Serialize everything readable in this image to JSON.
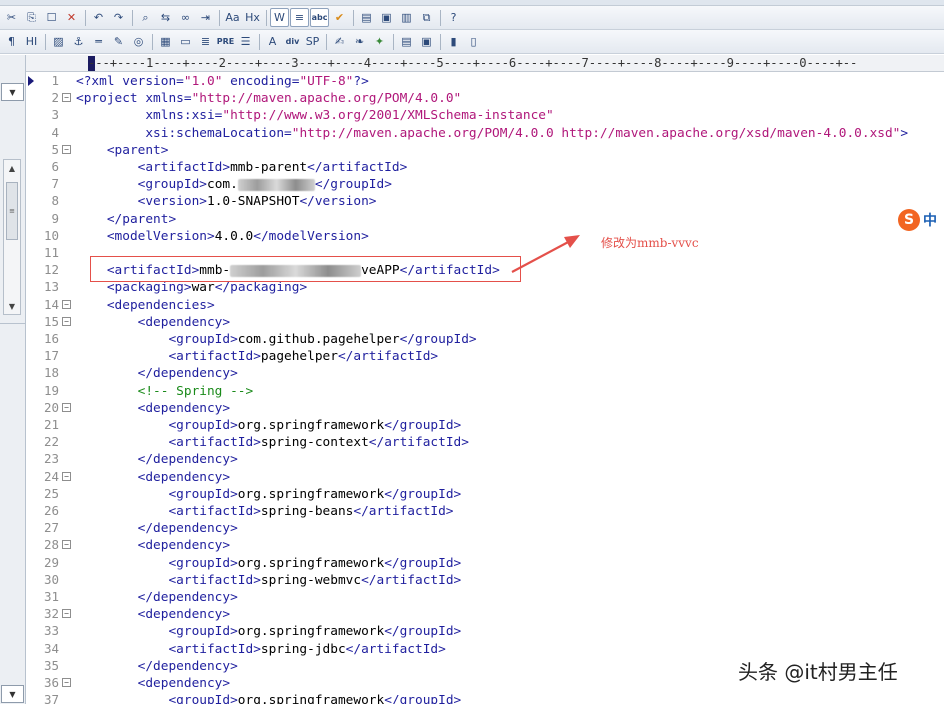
{
  "toolbar_row1": {
    "buttons": [
      {
        "icon": "cut-icon",
        "glyph": "✂"
      },
      {
        "icon": "copy-icon",
        "glyph": "⎘"
      },
      {
        "icon": "paste-icon",
        "glyph": "☐"
      },
      {
        "icon": "delete-icon",
        "glyph": "✕"
      },
      {
        "icon": "undo-icon",
        "glyph": "↶"
      },
      {
        "icon": "redo-icon",
        "glyph": "↷"
      },
      {
        "icon": "find-icon",
        "glyph": "⌕"
      },
      {
        "icon": "replace-icon",
        "glyph": "⇆"
      },
      {
        "icon": "link-icon",
        "glyph": "∞"
      },
      {
        "icon": "indent-icon",
        "glyph": "⇥"
      },
      {
        "icon": "font-icon",
        "glyph": "Aa"
      },
      {
        "icon": "html-icon",
        "glyph": "Hx"
      },
      {
        "icon": "wrap-icon",
        "glyph": "W"
      },
      {
        "icon": "list-icon",
        "glyph": "≡"
      },
      {
        "icon": "abc-icon",
        "glyph": "abc"
      },
      {
        "icon": "spellcheck-icon",
        "glyph": "✔"
      },
      {
        "icon": "view1-icon",
        "glyph": "▤"
      },
      {
        "icon": "view2-icon",
        "glyph": "▣"
      },
      {
        "icon": "view3-icon",
        "glyph": "▥"
      },
      {
        "icon": "window-icon",
        "glyph": "⧉"
      },
      {
        "icon": "help-icon",
        "glyph": "?"
      }
    ]
  },
  "toolbar_row2": {
    "buttons": [
      {
        "icon": "paragraph-icon",
        "glyph": "¶"
      },
      {
        "icon": "heading-icon",
        "glyph": "HI"
      },
      {
        "icon": "image-icon",
        "glyph": "▨"
      },
      {
        "icon": "anchor-icon",
        "glyph": "⚓"
      },
      {
        "icon": "rule-icon",
        "glyph": "═"
      },
      {
        "icon": "edit-icon",
        "glyph": "✎"
      },
      {
        "icon": "color-icon",
        "glyph": "◎"
      },
      {
        "icon": "table-icon",
        "glyph": "▦"
      },
      {
        "icon": "form-icon",
        "glyph": "▭"
      },
      {
        "icon": "align-icon",
        "glyph": "≣"
      },
      {
        "icon": "pre-icon",
        "glyph": "PRE"
      },
      {
        "icon": "ol-icon",
        "glyph": "☰"
      },
      {
        "icon": "format-icon",
        "glyph": "A"
      },
      {
        "icon": "div-icon",
        "glyph": "div"
      },
      {
        "icon": "span-icon",
        "glyph": "SP"
      },
      {
        "icon": "script-icon",
        "glyph": "✍"
      },
      {
        "icon": "style-icon",
        "glyph": "❧"
      },
      {
        "icon": "tools-icon",
        "glyph": "✦"
      },
      {
        "icon": "panel-icon",
        "glyph": "▤"
      },
      {
        "icon": "preview-icon",
        "glyph": "▣"
      },
      {
        "icon": "bookmark-icon",
        "glyph": "▮"
      },
      {
        "icon": "frame-icon",
        "glyph": "▯"
      }
    ]
  },
  "ruler": "---+----1----+----2----+----3----+----4----+----5----+----6----+----7----+----8----+----9----+----0----+--",
  "code_lines": [
    {
      "n": "1",
      "fold": "",
      "parts": [
        {
          "t": "tag",
          "s": "<?xml "
        },
        {
          "t": "attr",
          "s": "version="
        },
        {
          "t": "val",
          "s": "\"1.0\" "
        },
        {
          "t": "attr",
          "s": "encoding="
        },
        {
          "t": "val",
          "s": "\"UTF-8\""
        },
        {
          "t": "tag",
          "s": "?>"
        }
      ]
    },
    {
      "n": "2",
      "fold": "⊟",
      "parts": [
        {
          "t": "tag",
          "s": "<project "
        },
        {
          "t": "attr",
          "s": "xmlns="
        },
        {
          "t": "val",
          "s": "\"http://maven.apache.org/POM/4.0.0\""
        }
      ]
    },
    {
      "n": "3",
      "fold": "",
      "parts": [
        {
          "t": "text",
          "s": "         "
        },
        {
          "t": "attr",
          "s": "xmlns:xsi="
        },
        {
          "t": "val",
          "s": "\"http://www.w3.org/2001/XMLSchema-instance\""
        }
      ]
    },
    {
      "n": "4",
      "fold": "",
      "parts": [
        {
          "t": "text",
          "s": "         "
        },
        {
          "t": "attr",
          "s": "xsi:schemaLocation="
        },
        {
          "t": "val",
          "s": "\"http://maven.apache.org/POM/4.0.0 http://maven.apache.org/xsd/maven-4.0.0.xsd\""
        },
        {
          "t": "tag",
          "s": ">"
        }
      ]
    },
    {
      "n": "5",
      "fold": "⊟",
      "parts": [
        {
          "t": "text",
          "s": "    "
        },
        {
          "t": "tag",
          "s": "<parent>"
        }
      ]
    },
    {
      "n": "6",
      "fold": "",
      "parts": [
        {
          "t": "text",
          "s": "        "
        },
        {
          "t": "tag",
          "s": "<artifactId>"
        },
        {
          "t": "text",
          "s": "mmb-parent"
        },
        {
          "t": "tag",
          "s": "</artifactId>"
        }
      ]
    },
    {
      "n": "7",
      "fold": "",
      "parts": [
        {
          "t": "text",
          "s": "        "
        },
        {
          "t": "tag",
          "s": "<groupId>"
        },
        {
          "t": "text",
          "s": "com."
        },
        {
          "t": "blur",
          "s": "rxxxxxxxxx"
        },
        {
          "t": "tag",
          "s": "</groupId>"
        }
      ]
    },
    {
      "n": "8",
      "fold": "",
      "parts": [
        {
          "t": "text",
          "s": "        "
        },
        {
          "t": "tag",
          "s": "<version>"
        },
        {
          "t": "text",
          "s": "1.0-SNAPSHOT"
        },
        {
          "t": "tag",
          "s": "</version>"
        }
      ]
    },
    {
      "n": "9",
      "fold": "",
      "parts": [
        {
          "t": "text",
          "s": "    "
        },
        {
          "t": "tag",
          "s": "</parent>"
        }
      ]
    },
    {
      "n": "10",
      "fold": "",
      "parts": [
        {
          "t": "text",
          "s": "    "
        },
        {
          "t": "tag",
          "s": "<modelVersion>"
        },
        {
          "t": "text",
          "s": "4.0.0"
        },
        {
          "t": "tag",
          "s": "</modelVersion>"
        }
      ]
    },
    {
      "n": "11",
      "fold": "",
      "parts": []
    },
    {
      "n": "12",
      "fold": "",
      "parts": [
        {
          "t": "text",
          "s": "    "
        },
        {
          "t": "tag",
          "s": "<artifactId>"
        },
        {
          "t": "text",
          "s": "mmb-"
        },
        {
          "t": "blur",
          "s": "xxxxxxxxxxxxxxxxx"
        },
        {
          "t": "text",
          "s": "veAPP"
        },
        {
          "t": "tag",
          "s": "</artifactId>"
        }
      ]
    },
    {
      "n": "13",
      "fold": "",
      "parts": [
        {
          "t": "text",
          "s": "    "
        },
        {
          "t": "tag",
          "s": "<packaging>"
        },
        {
          "t": "text",
          "s": "war"
        },
        {
          "t": "tag",
          "s": "</packaging>"
        }
      ]
    },
    {
      "n": "14",
      "fold": "⊟",
      "parts": [
        {
          "t": "text",
          "s": "    "
        },
        {
          "t": "tag",
          "s": "<dependencies>"
        }
      ]
    },
    {
      "n": "15",
      "fold": "⊟",
      "parts": [
        {
          "t": "text",
          "s": "        "
        },
        {
          "t": "tag",
          "s": "<dependency>"
        }
      ]
    },
    {
      "n": "16",
      "fold": "",
      "parts": [
        {
          "t": "text",
          "s": "            "
        },
        {
          "t": "tag",
          "s": "<groupId>"
        },
        {
          "t": "text",
          "s": "com.github.pagehelper"
        },
        {
          "t": "tag",
          "s": "</groupId>"
        }
      ]
    },
    {
      "n": "17",
      "fold": "",
      "parts": [
        {
          "t": "text",
          "s": "            "
        },
        {
          "t": "tag",
          "s": "<artifactId>"
        },
        {
          "t": "text",
          "s": "pagehelper"
        },
        {
          "t": "tag",
          "s": "</artifactId>"
        }
      ]
    },
    {
      "n": "18",
      "fold": "",
      "parts": [
        {
          "t": "text",
          "s": "        "
        },
        {
          "t": "tag",
          "s": "</dependency>"
        }
      ]
    },
    {
      "n": "19",
      "fold": "",
      "parts": [
        {
          "t": "text",
          "s": "        "
        },
        {
          "t": "com",
          "s": "<!-- Spring -->"
        }
      ]
    },
    {
      "n": "20",
      "fold": "⊟",
      "parts": [
        {
          "t": "text",
          "s": "        "
        },
        {
          "t": "tag",
          "s": "<dependency>"
        }
      ]
    },
    {
      "n": "21",
      "fold": "",
      "parts": [
        {
          "t": "text",
          "s": "            "
        },
        {
          "t": "tag",
          "s": "<groupId>"
        },
        {
          "t": "text",
          "s": "org.springframework"
        },
        {
          "t": "tag",
          "s": "</groupId>"
        }
      ]
    },
    {
      "n": "22",
      "fold": "",
      "parts": [
        {
          "t": "text",
          "s": "            "
        },
        {
          "t": "tag",
          "s": "<artifactId>"
        },
        {
          "t": "text",
          "s": "spring-context"
        },
        {
          "t": "tag",
          "s": "</artifactId>"
        }
      ]
    },
    {
      "n": "23",
      "fold": "",
      "parts": [
        {
          "t": "text",
          "s": "        "
        },
        {
          "t": "tag",
          "s": "</dependency>"
        }
      ]
    },
    {
      "n": "24",
      "fold": "⊟",
      "parts": [
        {
          "t": "text",
          "s": "        "
        },
        {
          "t": "tag",
          "s": "<dependency>"
        }
      ]
    },
    {
      "n": "25",
      "fold": "",
      "parts": [
        {
          "t": "text",
          "s": "            "
        },
        {
          "t": "tag",
          "s": "<groupId>"
        },
        {
          "t": "text",
          "s": "org.springframework"
        },
        {
          "t": "tag",
          "s": "</groupId>"
        }
      ]
    },
    {
      "n": "26",
      "fold": "",
      "parts": [
        {
          "t": "text",
          "s": "            "
        },
        {
          "t": "tag",
          "s": "<artifactId>"
        },
        {
          "t": "text",
          "s": "spring-beans"
        },
        {
          "t": "tag",
          "s": "</artifactId>"
        }
      ]
    },
    {
      "n": "27",
      "fold": "",
      "parts": [
        {
          "t": "text",
          "s": "        "
        },
        {
          "t": "tag",
          "s": "</dependency>"
        }
      ]
    },
    {
      "n": "28",
      "fold": "⊟",
      "parts": [
        {
          "t": "text",
          "s": "        "
        },
        {
          "t": "tag",
          "s": "<dependency>"
        }
      ]
    },
    {
      "n": "29",
      "fold": "",
      "parts": [
        {
          "t": "text",
          "s": "            "
        },
        {
          "t": "tag",
          "s": "<groupId>"
        },
        {
          "t": "text",
          "s": "org.springframework"
        },
        {
          "t": "tag",
          "s": "</groupId>"
        }
      ]
    },
    {
      "n": "30",
      "fold": "",
      "parts": [
        {
          "t": "text",
          "s": "            "
        },
        {
          "t": "tag",
          "s": "<artifactId>"
        },
        {
          "t": "text",
          "s": "spring-webmvc"
        },
        {
          "t": "tag",
          "s": "</artifactId>"
        }
      ]
    },
    {
      "n": "31",
      "fold": "",
      "parts": [
        {
          "t": "text",
          "s": "        "
        },
        {
          "t": "tag",
          "s": "</dependency>"
        }
      ]
    },
    {
      "n": "32",
      "fold": "⊟",
      "parts": [
        {
          "t": "text",
          "s": "        "
        },
        {
          "t": "tag",
          "s": "<dependency>"
        }
      ]
    },
    {
      "n": "33",
      "fold": "",
      "parts": [
        {
          "t": "text",
          "s": "            "
        },
        {
          "t": "tag",
          "s": "<groupId>"
        },
        {
          "t": "text",
          "s": "org.springframework"
        },
        {
          "t": "tag",
          "s": "</groupId>"
        }
      ]
    },
    {
      "n": "34",
      "fold": "",
      "parts": [
        {
          "t": "text",
          "s": "            "
        },
        {
          "t": "tag",
          "s": "<artifactId>"
        },
        {
          "t": "text",
          "s": "spring-jdbc"
        },
        {
          "t": "tag",
          "s": "</artifactId>"
        }
      ]
    },
    {
      "n": "35",
      "fold": "",
      "parts": [
        {
          "t": "text",
          "s": "        "
        },
        {
          "t": "tag",
          "s": "</dependency>"
        }
      ]
    },
    {
      "n": "36",
      "fold": "⊟",
      "parts": [
        {
          "t": "text",
          "s": "        "
        },
        {
          "t": "tag",
          "s": "<dependency>"
        }
      ]
    },
    {
      "n": "37",
      "fold": "",
      "parts": [
        {
          "t": "text",
          "s": "            "
        },
        {
          "t": "tag",
          "s": "<groupId>"
        },
        {
          "t": "text",
          "s": "org.springframework"
        },
        {
          "t": "tag",
          "s": "</groupId>"
        }
      ]
    }
  ],
  "current_line": "1",
  "annotation": {
    "text": "修改为mmb-vvvc",
    "color": "#e4504a"
  },
  "ime_badge": {
    "logo": "S",
    "label": "中"
  },
  "watermark": "头条 @it村男主任",
  "colors": {
    "tag": "#1f1f9e",
    "text": "#000000",
    "value": "#b0177a",
    "comment": "#1a8a1a",
    "line_number": "#8e8e8e"
  }
}
